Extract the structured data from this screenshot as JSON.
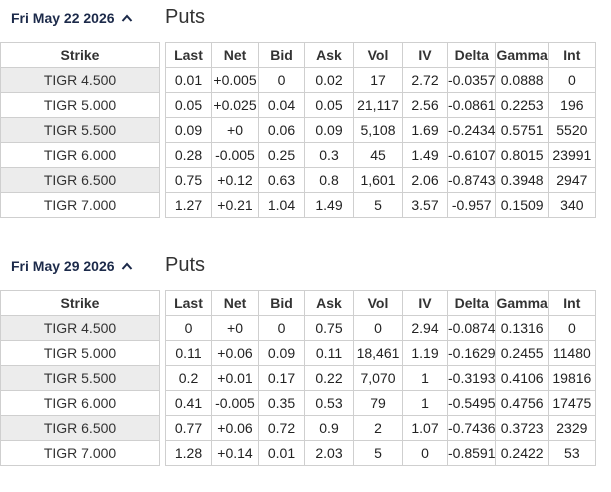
{
  "sections": [
    {
      "date_label": "Fri May 22 2026",
      "title": "Puts",
      "strike_header": "Strike",
      "headers": [
        "Last",
        "Net",
        "Bid",
        "Ask",
        "Vol",
        "IV",
        "Delta",
        "Gamma",
        "Int"
      ],
      "rows": [
        {
          "strike": "TIGR 4.500",
          "last": "0.01",
          "net": "+0.005",
          "bid": "0",
          "ask": "0.02",
          "vol": "17",
          "iv": "2.72",
          "delta": "-0.0357",
          "gamma": "0.0888",
          "int": "0"
        },
        {
          "strike": "TIGR 5.000",
          "last": "0.05",
          "net": "+0.025",
          "bid": "0.04",
          "ask": "0.05",
          "vol": "21,117",
          "iv": "2.56",
          "delta": "-0.0861",
          "gamma": "0.2253",
          "int": "196"
        },
        {
          "strike": "TIGR 5.500",
          "last": "0.09",
          "net": "+0",
          "bid": "0.06",
          "ask": "0.09",
          "vol": "5,108",
          "iv": "1.69",
          "delta": "-0.2434",
          "gamma": "0.5751",
          "int": "5520"
        },
        {
          "strike": "TIGR 6.000",
          "last": "0.28",
          "net": "-0.005",
          "bid": "0.25",
          "ask": "0.3",
          "vol": "45",
          "iv": "1.49",
          "delta": "-0.6107",
          "gamma": "0.8015",
          "int": "23991"
        },
        {
          "strike": "TIGR 6.500",
          "last": "0.75",
          "net": "+0.12",
          "bid": "0.63",
          "ask": "0.8",
          "vol": "1,601",
          "iv": "2.06",
          "delta": "-0.8743",
          "gamma": "0.3948",
          "int": "2947"
        },
        {
          "strike": "TIGR 7.000",
          "last": "1.27",
          "net": "+0.21",
          "bid": "1.04",
          "ask": "1.49",
          "vol": "5",
          "iv": "3.57",
          "delta": "-0.957",
          "gamma": "0.1509",
          "int": "340"
        }
      ]
    },
    {
      "date_label": "Fri May 29 2026",
      "title": "Puts",
      "strike_header": "Strike",
      "headers": [
        "Last",
        "Net",
        "Bid",
        "Ask",
        "Vol",
        "IV",
        "Delta",
        "Gamma",
        "Int"
      ],
      "rows": [
        {
          "strike": "TIGR 4.500",
          "last": "0",
          "net": "+0",
          "bid": "0",
          "ask": "0.75",
          "vol": "0",
          "iv": "2.94",
          "delta": "-0.0874",
          "gamma": "0.1316",
          "int": "0"
        },
        {
          "strike": "TIGR 5.000",
          "last": "0.11",
          "net": "+0.06",
          "bid": "0.09",
          "ask": "0.11",
          "vol": "18,461",
          "iv": "1.19",
          "delta": "-0.1629",
          "gamma": "0.2455",
          "int": "11480"
        },
        {
          "strike": "TIGR 5.500",
          "last": "0.2",
          "net": "+0.01",
          "bid": "0.17",
          "ask": "0.22",
          "vol": "7,070",
          "iv": "1",
          "delta": "-0.3193",
          "gamma": "0.4106",
          "int": "19816"
        },
        {
          "strike": "TIGR 6.000",
          "last": "0.41",
          "net": "-0.005",
          "bid": "0.35",
          "ask": "0.53",
          "vol": "79",
          "iv": "1",
          "delta": "-0.5495",
          "gamma": "0.4756",
          "int": "17475"
        },
        {
          "strike": "TIGR 6.500",
          "last": "0.77",
          "net": "+0.06",
          "bid": "0.72",
          "ask": "0.9",
          "vol": "2",
          "iv": "1.07",
          "delta": "-0.7436",
          "gamma": "0.3723",
          "int": "2329"
        },
        {
          "strike": "TIGR 7.000",
          "last": "1.28",
          "net": "+0.14",
          "bid": "0.01",
          "ask": "2.03",
          "vol": "5",
          "iv": "0",
          "delta": "-0.8591",
          "gamma": "0.2422",
          "int": "53"
        }
      ]
    }
  ],
  "colors": {
    "positive": "#1a7f1a",
    "negative": "#c0392b",
    "header_text": "#1c2a4a"
  },
  "icons": {
    "collapse": "chevron-up-icon"
  }
}
